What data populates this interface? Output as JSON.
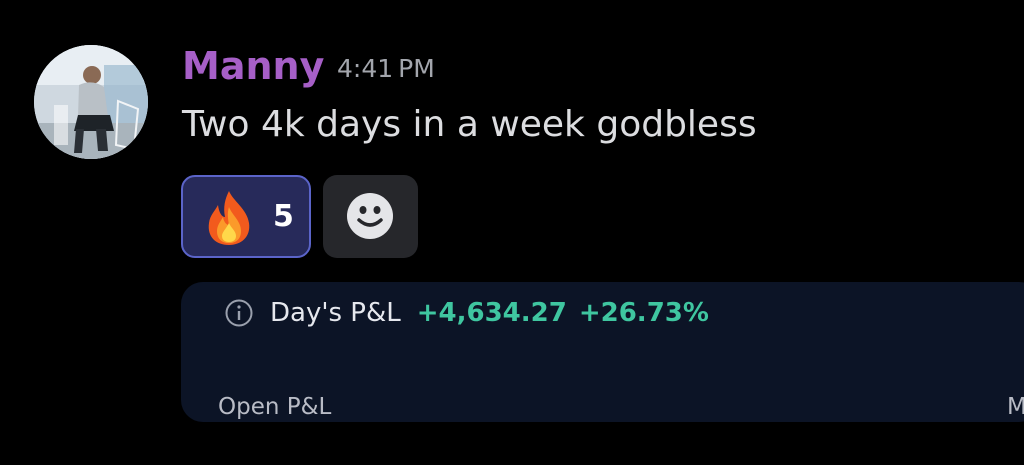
{
  "message": {
    "username": "Manny",
    "timestamp": "4:41 PM",
    "text": "Two 4k days in a week godbless",
    "avatar_icon": "user-avatar-photo",
    "username_color": "#a65fc7"
  },
  "reactions": [
    {
      "emoji_icon": "fire-emoji",
      "count": "5"
    }
  ],
  "add_reaction": {
    "icon": "smiley-face-icon"
  },
  "embed": {
    "info_icon": "info-circle-icon",
    "label": "Day's P&L",
    "value": "+4,634.27",
    "percent": "+26.73%",
    "value_color": "#3fc6a0",
    "footer_left": "Open P&L",
    "footer_right": "M"
  }
}
